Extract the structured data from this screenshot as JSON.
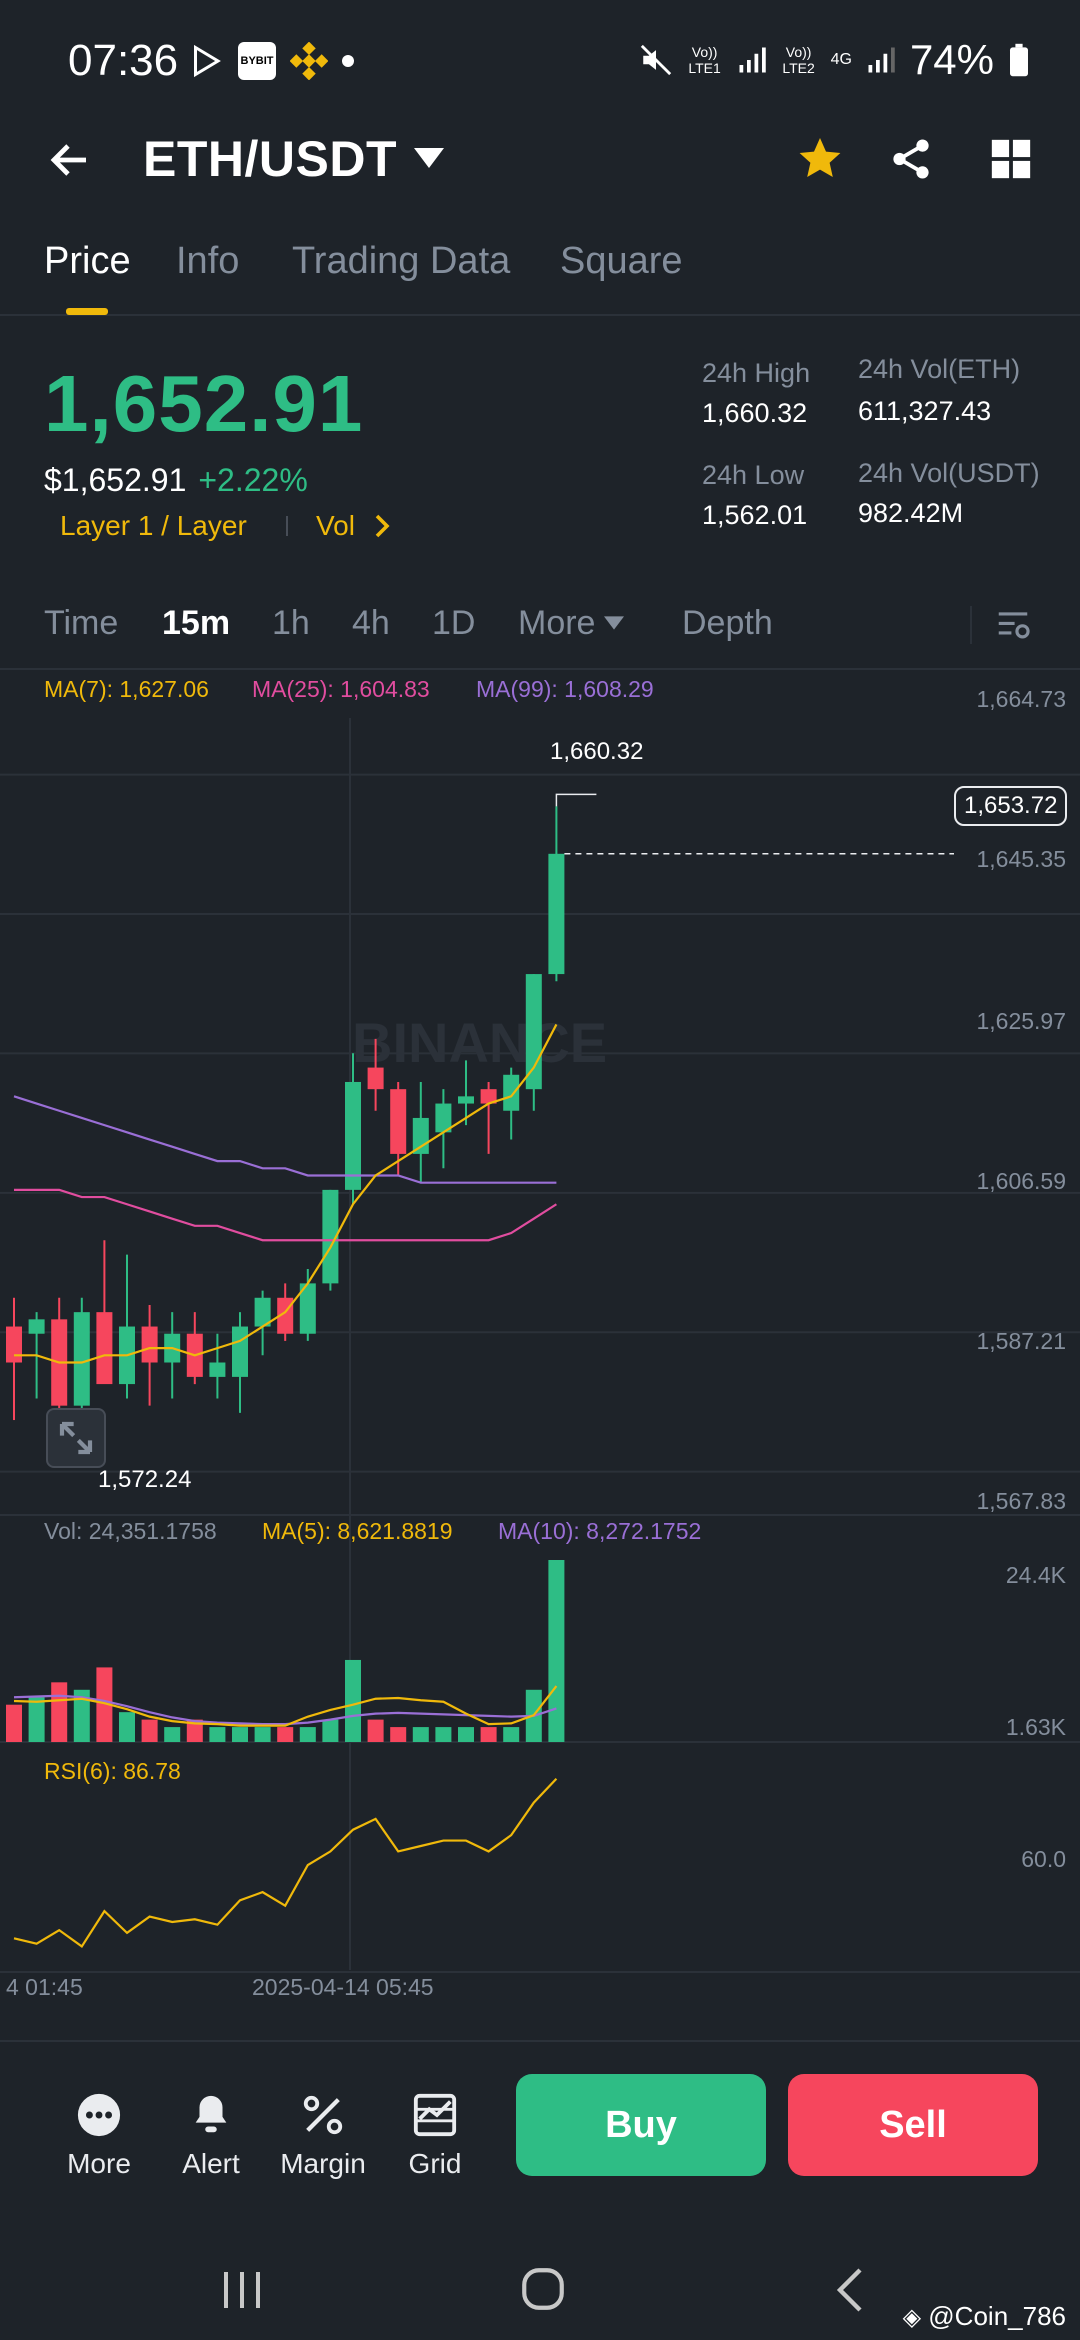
{
  "status": {
    "time": "07:36",
    "battery": "74%",
    "net1": "Vo)) LTE1",
    "net2": "Vo)) LTE2",
    "net4g": "4G"
  },
  "header": {
    "pair": "ETH/USDT"
  },
  "tabs": [
    "Price",
    "Info",
    "Trading Data",
    "Square"
  ],
  "ticker": {
    "last": "1,652.91",
    "usd": "$1,652.91",
    "change": "+2.22%",
    "tag1": "Layer 1 / Layer",
    "tag2": "Vol",
    "high_label": "24h High",
    "high": "1,660.32",
    "low_label": "24h Low",
    "low": "1,562.01",
    "vol_eth_label": "24h Vol(ETH)",
    "vol_eth": "611,327.43",
    "vol_usdt_label": "24h Vol(USDT)",
    "vol_usdt": "982.42M"
  },
  "intervals": [
    "Time",
    "15m",
    "1h",
    "4h",
    "1D",
    "More",
    "Depth"
  ],
  "ma": {
    "ma7": "MA(7): 1,627.06",
    "ma25": "MA(25): 1,604.83",
    "ma99": "MA(99): 1,608.29"
  },
  "price_axis": [
    "1,664.73",
    "1,645.35",
    "1,625.97",
    "1,606.59",
    "1,587.21",
    "1,567.83"
  ],
  "current_tag": "1,653.72",
  "high_mark": "1,660.32",
  "low_mark": "1,572.24",
  "watermark": "BINANCE",
  "volume": {
    "vol": "Vol: 24,351.1758",
    "ma5": "MA(5): 8,621.8819",
    "ma10": "MA(10): 8,272.1752",
    "axis_top": "24.4K",
    "axis_bot": "1.63K"
  },
  "rsi": {
    "label": "RSI(6): 86.78",
    "axis": "60.0"
  },
  "time_axis": [
    "4 01:45",
    "2025-04-14 05:45"
  ],
  "bottom": {
    "more": "More",
    "alert": "Alert",
    "margin": "Margin",
    "grid": "Grid",
    "buy": "Buy",
    "sell": "Sell"
  },
  "credit": "@Coin_786",
  "colors": {
    "up": "#2ebd85",
    "down": "#f6465d",
    "accent": "#f0b90b",
    "bg": "#1e2329",
    "ma7": "#f0b90b",
    "ma25": "#e14d9f",
    "ma99": "#9a6fd6"
  },
  "chart_data": {
    "type": "candlestick",
    "candles": [
      {
        "o": 1588,
        "h": 1592,
        "l": 1575,
        "c": 1583
      },
      {
        "o": 1587,
        "h": 1590,
        "l": 1578,
        "c": 1589
      },
      {
        "o": 1589,
        "h": 1592,
        "l": 1572,
        "c": 1577
      },
      {
        "o": 1577,
        "h": 1592,
        "l": 1575,
        "c": 1590
      },
      {
        "o": 1590,
        "h": 1600,
        "l": 1582,
        "c": 1580
      },
      {
        "o": 1580,
        "h": 1598,
        "l": 1578,
        "c": 1588
      },
      {
        "o": 1588,
        "h": 1591,
        "l": 1577,
        "c": 1583
      },
      {
        "o": 1583,
        "h": 1590,
        "l": 1578,
        "c": 1587
      },
      {
        "o": 1587,
        "h": 1590,
        "l": 1580,
        "c": 1581
      },
      {
        "o": 1581,
        "h": 1587,
        "l": 1578,
        "c": 1583
      },
      {
        "o": 1581,
        "h": 1590,
        "l": 1576,
        "c": 1588
      },
      {
        "o": 1588,
        "h": 1593,
        "l": 1584,
        "c": 1592
      },
      {
        "o": 1592,
        "h": 1594,
        "l": 1586,
        "c": 1587
      },
      {
        "o": 1587,
        "h": 1596,
        "l": 1586,
        "c": 1594
      },
      {
        "o": 1594,
        "h": 1607,
        "l": 1593,
        "c": 1607
      },
      {
        "o": 1607,
        "h": 1626,
        "l": 1605,
        "c": 1622
      },
      {
        "o": 1624,
        "h": 1628,
        "l": 1618,
        "c": 1621
      },
      {
        "o": 1621,
        "h": 1622,
        "l": 1609,
        "c": 1612
      },
      {
        "o": 1612,
        "h": 1622,
        "l": 1608,
        "c": 1617
      },
      {
        "o": 1615,
        "h": 1621,
        "l": 1610,
        "c": 1619
      },
      {
        "o": 1619,
        "h": 1625,
        "l": 1616,
        "c": 1620
      },
      {
        "o": 1621,
        "h": 1622,
        "l": 1612,
        "c": 1619
      },
      {
        "o": 1618,
        "h": 1624,
        "l": 1614,
        "c": 1623
      },
      {
        "o": 1621,
        "h": 1637,
        "l": 1618,
        "c": 1637
      },
      {
        "o": 1637,
        "h": 1660.32,
        "l": 1636,
        "c": 1653.72
      }
    ],
    "ma7": [
      1584,
      1584,
      1583,
      1583,
      1584,
      1584,
      1585,
      1585,
      1584,
      1585,
      1586,
      1588,
      1590,
      1594,
      1599,
      1605,
      1609,
      1611,
      1613,
      1615,
      1617,
      1619,
      1620,
      1624,
      1630
    ],
    "ma25": [
      1607,
      1607,
      1607,
      1606,
      1606,
      1605,
      1604,
      1603,
      1602,
      1602,
      1601,
      1600,
      1600,
      1600,
      1600,
      1600,
      1600,
      1600,
      1600,
      1600,
      1600,
      1600,
      1601,
      1603,
      1605
    ],
    "ma99": [
      1620,
      1619,
      1618,
      1617,
      1616,
      1615,
      1614,
      1613,
      1612,
      1611,
      1611,
      1610,
      1610,
      1609,
      1609,
      1609,
      1609,
      1609,
      1608,
      1608,
      1608,
      1608,
      1608,
      1608,
      1608
    ],
    "volumes": [
      5,
      6,
      8,
      7,
      10,
      4,
      3,
      2,
      3,
      2,
      2,
      2,
      2,
      2,
      3,
      11,
      3,
      2,
      2,
      2,
      2,
      2,
      2,
      7,
      24.4
    ],
    "vol_ma5": [
      5.5,
      5.4,
      5.6,
      5.8,
      5.2,
      4.4,
      3.4,
      2.8,
      2.5,
      2.4,
      2.2,
      2.2,
      2.2,
      3.4,
      4.3,
      5.0,
      5.8,
      5.9,
      5.6,
      5.4,
      3.8,
      2.4,
      2.5,
      3.6,
      7.5
    ],
    "vol_ma10": [
      6.0,
      6.1,
      6.2,
      6.0,
      5.5,
      4.8,
      4.0,
      3.3,
      2.8,
      2.6,
      2.5,
      2.4,
      2.4,
      2.6,
      3.0,
      3.5,
      3.8,
      3.9,
      3.8,
      3.7,
      3.6,
      3.5,
      3.4,
      3.5,
      4.5
    ],
    "rsi": [
      28,
      26,
      31,
      25,
      38,
      30,
      36,
      34,
      35,
      33,
      42,
      45,
      40,
      55,
      60,
      68,
      72,
      60,
      62,
      64,
      64,
      60,
      66,
      78,
      86.78
    ],
    "price_min": 1567.83,
    "price_max": 1664.73
  }
}
